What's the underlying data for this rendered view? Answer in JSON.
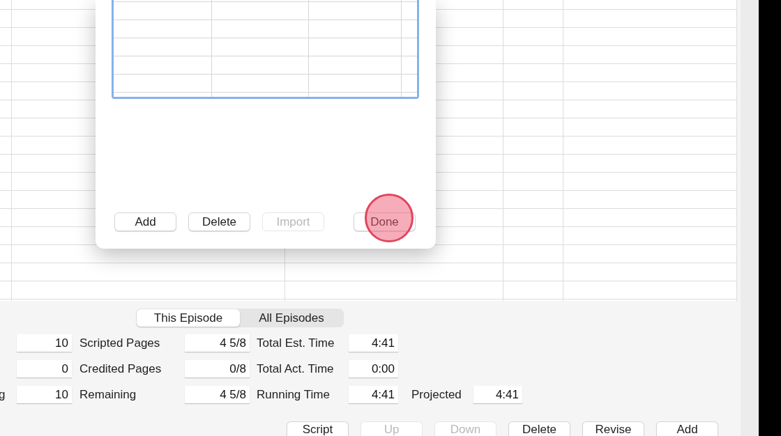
{
  "dialog": {
    "buttons": [
      {
        "label": "Add",
        "disabled": false,
        "touched": false
      },
      {
        "label": "Delete",
        "disabled": false,
        "touched": false
      },
      {
        "label": "Import",
        "disabled": true,
        "touched": false
      },
      {
        "label": "Done",
        "disabled": false,
        "touched": true
      }
    ]
  },
  "scope_tabs": [
    {
      "label": "This Episode",
      "selected": true
    },
    {
      "label": "All Episodes",
      "selected": false
    }
  ],
  "stats": [
    {
      "count": "10",
      "count_label": "Scripted Pages",
      "pages": "4 5/8",
      "pages_label": "Total Est. Time",
      "time": "4:41"
    },
    {
      "count": "0",
      "count_label": "Credited Pages",
      "pages": "0/8",
      "pages_label": "Total Act. Time",
      "time": "0:00"
    },
    {
      "lead": "g",
      "count": "10",
      "count_label": "Remaining",
      "pages": "4 5/8",
      "pages_label": "Running Time",
      "time": "4:41",
      "extra_label": "Projected",
      "extra": "4:41"
    }
  ],
  "buttons": [
    {
      "label": "Script",
      "disabled": false
    },
    {
      "label": "Up",
      "disabled": true
    },
    {
      "label": "Down",
      "disabled": true
    },
    {
      "label": "Delete",
      "disabled": false
    },
    {
      "label": "Revise",
      "disabled": false
    },
    {
      "label": "Add",
      "disabled": false
    }
  ]
}
